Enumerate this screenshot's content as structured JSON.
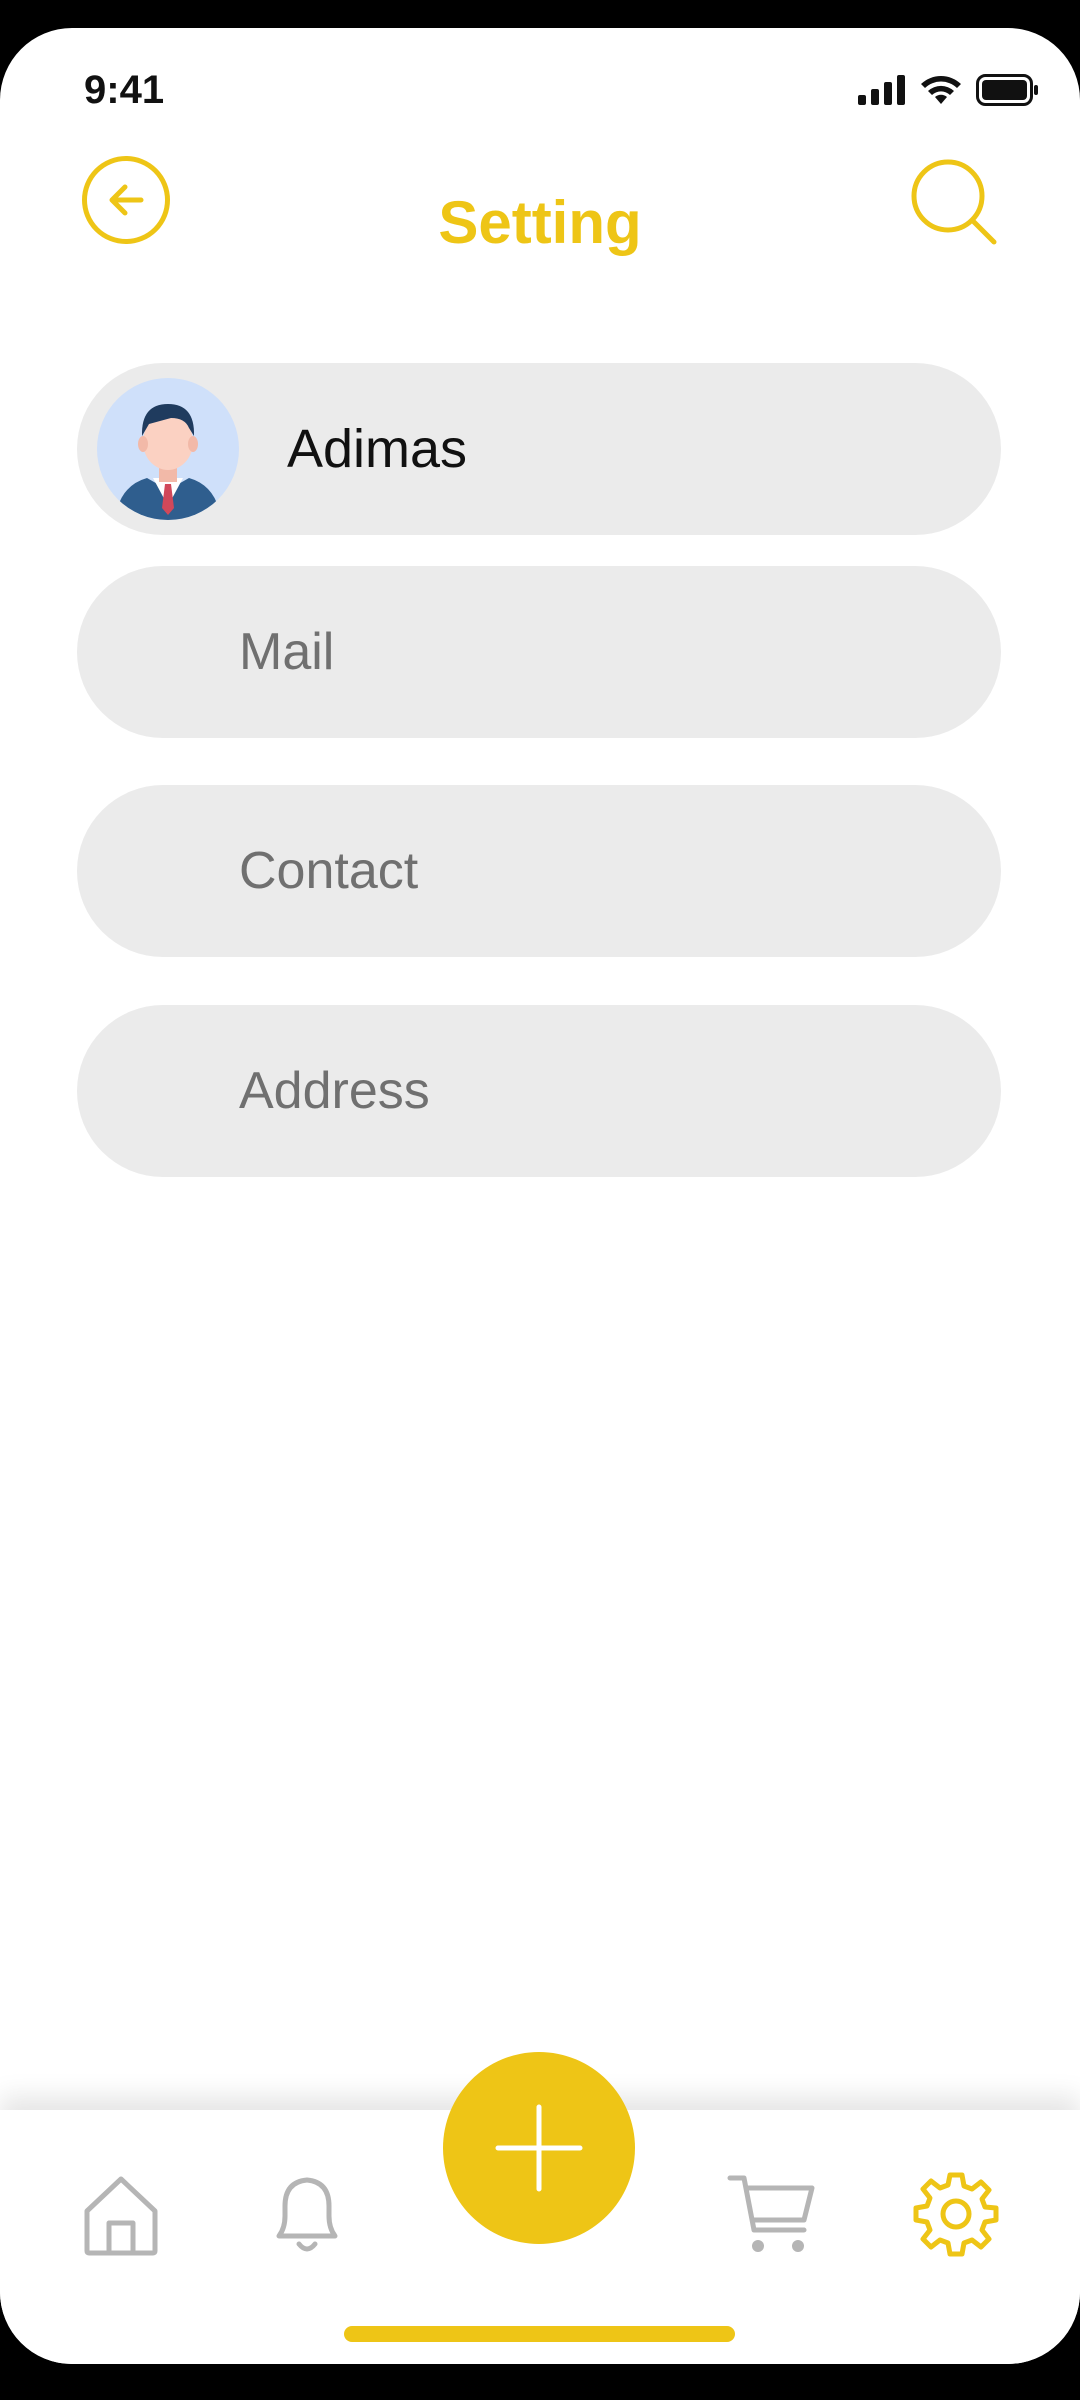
{
  "status_bar": {
    "time": "9:41"
  },
  "header": {
    "title": "Setting",
    "back_icon": "arrow-left-circle-icon",
    "search_icon": "search-icon"
  },
  "profile": {
    "name": "Adimas",
    "avatar_icon": "businessman-avatar"
  },
  "settings_items": [
    {
      "label": "Mail"
    },
    {
      "label": "Contact"
    },
    {
      "label": "Address"
    }
  ],
  "tab_bar": {
    "items": [
      {
        "name": "home",
        "icon": "home-icon",
        "active": false
      },
      {
        "name": "notifications",
        "icon": "bell-icon",
        "active": false
      },
      {
        "name": "add",
        "icon": "plus-icon",
        "active": false
      },
      {
        "name": "cart",
        "icon": "cart-icon",
        "active": false
      },
      {
        "name": "settings",
        "icon": "gear-icon",
        "active": true
      }
    ]
  },
  "colors": {
    "accent": "#EEC516",
    "pill_background": "#EBEBEB",
    "inactive_icon": "#B5B5B5",
    "label_text": "#707070"
  }
}
